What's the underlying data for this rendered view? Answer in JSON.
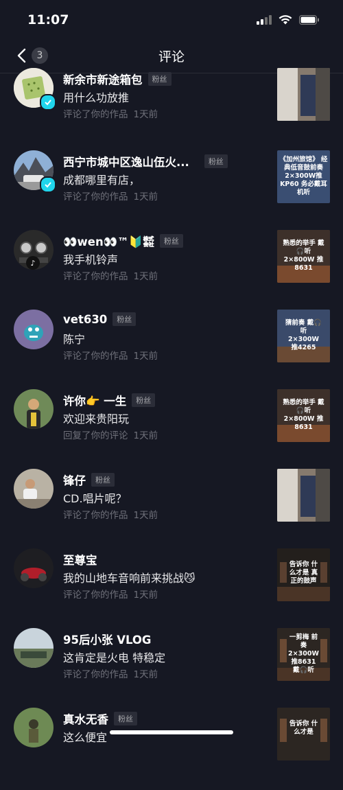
{
  "status": {
    "time": "11:07"
  },
  "nav": {
    "back_count": "3",
    "title": "评论"
  },
  "meta_texts": {
    "commented": "评论了你的作品",
    "replied": "回复了你的评论"
  },
  "items": [
    {
      "name": "新余市新途箱包",
      "fan": "粉丝",
      "comment": "用什么功放推",
      "action": "评论了你的作品",
      "time": "1天前",
      "thumb_text": ""
    },
    {
      "name": "西宁市城中区逸山伍火...",
      "fan": "粉丝",
      "comment": "成都哪里有店，",
      "action": "评论了你的作品",
      "time": "1天前",
      "thumb_text": "《加州旅馆》 经典低音鼓前奏 2×300W推KP60 务必戴耳机听"
    },
    {
      "name": "👀wen👀™🔰㍿",
      "fan": "粉丝",
      "comment": "我手机铃声",
      "action": "评论了你的作品",
      "time": "1天前",
      "thumb_text": "熟悉的举手 戴🎧听 2×800W 推8631"
    },
    {
      "name": "vet630",
      "fan": "粉丝",
      "comment": "陈宁",
      "action": "评论了你的作品",
      "time": "1天前",
      "thumb_text": "猜前奏 戴🎧听 2×300W 推4265"
    },
    {
      "name": "许你👉 一生",
      "fan": "粉丝",
      "comment": "欢迎来贵阳玩",
      "action": "回复了你的评论",
      "time": "1天前",
      "thumb_text": "熟悉的举手 戴🎧听 2×800W 推8631"
    },
    {
      "name": "锋仔",
      "fan": "粉丝",
      "comment": "CD.唱片呢？",
      "action": "评论了你的作品",
      "time": "1天前",
      "thumb_text": ""
    },
    {
      "name": "至尊宝",
      "fan": "",
      "comment": "我的山地车音响前来挑战😼",
      "action": "评论了你的作品",
      "time": "1天前",
      "thumb_text": "告诉你 什么才是 真正的鼓声"
    },
    {
      "name": "95后小张 VLOG",
      "fan": "",
      "comment": "这肯定是火电 特稳定",
      "action": "评论了你的作品",
      "time": "1天前",
      "thumb_text": "一剪梅 前奏 2×300W 推8631 戴🎧听"
    },
    {
      "name": "真水无香",
      "fan": "粉丝",
      "comment": "这么便宜",
      "action": "",
      "time": "",
      "thumb_text": "告诉你 什么才是"
    }
  ]
}
